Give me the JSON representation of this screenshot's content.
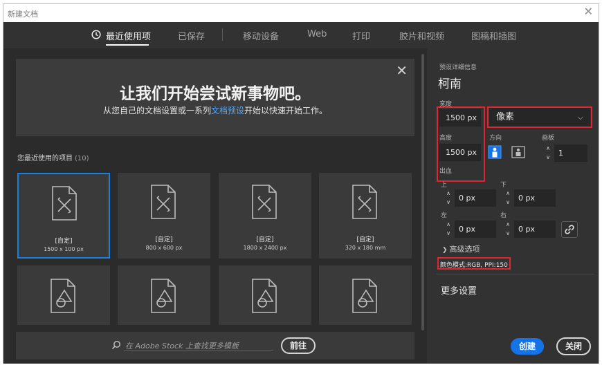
{
  "window": {
    "title": "新建文档",
    "close_glyph": "✕"
  },
  "tabs": [
    {
      "label": "最近使用项",
      "icon": "clock-icon",
      "active": true
    },
    {
      "label": "已保存"
    },
    {
      "label": "移动设备"
    },
    {
      "label": "Web"
    },
    {
      "label": "打印"
    },
    {
      "label": "胶片和视频"
    },
    {
      "label": "图稿和插图"
    }
  ],
  "banner": {
    "title": "让我们开始尝试新事物吧。",
    "sub_before": "从您自己的文档设置或一系列",
    "sub_link": "文档预设",
    "sub_after": "开始以快速开始工作。",
    "close_glyph": "✕"
  },
  "recent": {
    "label": "您最近使用的项目",
    "count": "(10)"
  },
  "cards": [
    {
      "name": "[自定]",
      "size": "1500 x 100 px",
      "selected": true
    },
    {
      "name": "[自定]",
      "size": "800 x 600 px"
    },
    {
      "name": "[自定]",
      "size": "1800 x 2400 px"
    },
    {
      "name": "[自定]",
      "size": "320 x 180 mm"
    }
  ],
  "stock": {
    "placeholder": "在 Adobe Stock 上查找更多模板",
    "go_label": "前往"
  },
  "details": {
    "heading": "预设详细信息",
    "name": "柯南",
    "width_label": "宽度",
    "width_value": "1500 px",
    "unit": "像素",
    "height_label": "高度",
    "height_value": "1500 px",
    "orientation_label": "方向",
    "artboard_label": "画板",
    "artboard_value": "1",
    "bleed_label": "出血",
    "top_label": "上",
    "top_value": "0 px",
    "bottom_label": "下",
    "bottom_value": "0 px",
    "left_label": "左",
    "left_value": "0 px",
    "right_label": "右",
    "right_value": "0 px",
    "advanced_label": "高级选项",
    "color_mode": "颜色模式:RGB, PPI:150",
    "more_settings": "更多设置",
    "create_label": "创建",
    "close_label": "关闭"
  },
  "colors": {
    "accent": "#1473e6",
    "highlight": "#e0262f",
    "link": "#4ea6ff"
  }
}
